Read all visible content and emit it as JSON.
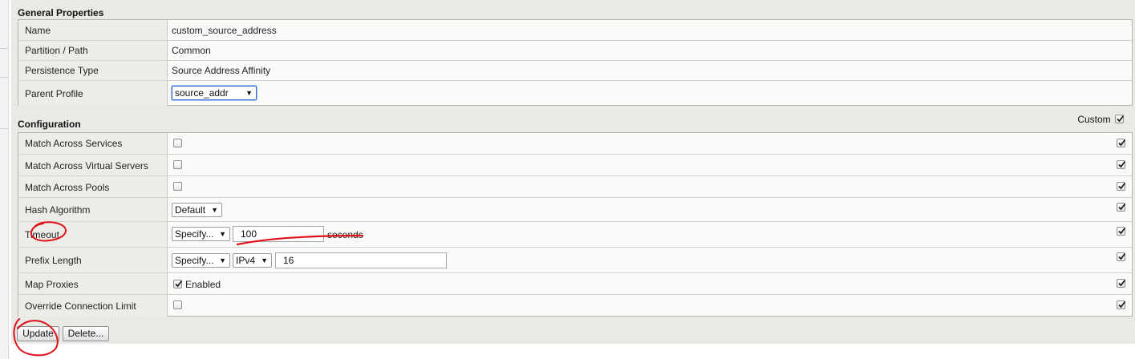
{
  "general": {
    "title": "General Properties",
    "rows": [
      {
        "label": "Name",
        "value": "custom_source_address"
      },
      {
        "label": "Partition / Path",
        "value": "Common"
      },
      {
        "label": "Persistence Type",
        "value": "Source Address Affinity"
      },
      {
        "label": "Parent Profile",
        "value": "source_addr"
      }
    ]
  },
  "configuration": {
    "title": "Configuration",
    "custom_label": "Custom",
    "custom_checked": true,
    "rows": [
      {
        "label": "Match Across Services",
        "checked": false,
        "custom": true
      },
      {
        "label": "Match Across Virtual Servers",
        "checked": false,
        "custom": true
      },
      {
        "label": "Match Across Pools",
        "checked": false,
        "custom": true
      },
      {
        "label": "Hash Algorithm",
        "select": "Default",
        "custom": true
      },
      {
        "label": "Timeout",
        "select": "Specify...",
        "input": "100",
        "suffix": "seconds",
        "custom": true
      },
      {
        "label": "Prefix Length",
        "select": "Specify...",
        "select2": "IPv4",
        "input": "16",
        "custom": true
      },
      {
        "label": "Map Proxies",
        "checked": true,
        "checkbox_label": "Enabled",
        "custom": true
      },
      {
        "label": "Override Connection Limit",
        "checked": false,
        "custom": true
      }
    ]
  },
  "buttons": {
    "update": "Update",
    "delete": "Delete..."
  },
  "icons": {
    "dropdown": "chevron-down-icon",
    "check": "checkmark-icon"
  },
  "colors": {
    "annotation": "#e0101a",
    "focus": "#3b6fd6"
  }
}
